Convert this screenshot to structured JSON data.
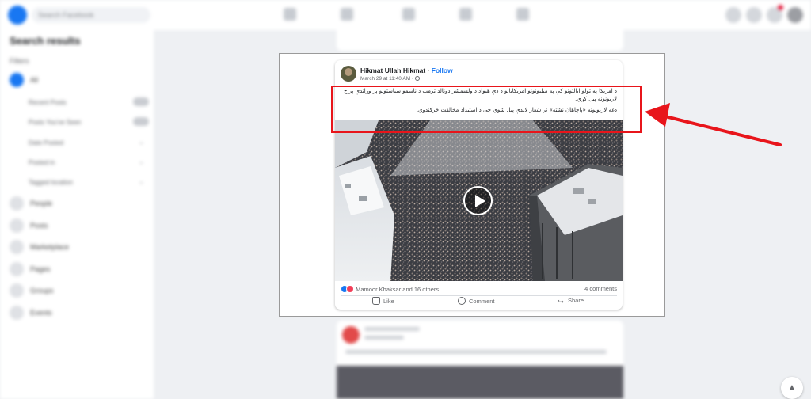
{
  "background": {
    "search_placeholder": "Search Facebook",
    "sidebar": {
      "title": "Search results",
      "filters_label": "Filters",
      "all_label": "All",
      "options": [
        "Recent Posts",
        "Posts You've Seen",
        "Date Posted",
        "Posted in",
        "Tagged location"
      ],
      "categories": [
        "People",
        "Posts",
        "Marketplace",
        "Pages",
        "Groups",
        "Events"
      ]
    }
  },
  "post": {
    "author": "Hikmat Ullah Hikmat",
    "separator": "·",
    "follow_label": "Follow",
    "timestamp": "March 29 at 11:40 AM ·",
    "text_line1": "د امریکا په ټولو ایالتونو کې په میلیونونو امریکایانو د دې هیواد د ولسمشر ډونالډ ټرمپ د ناسمو سیاستونو پر وړاندې پراخ لاریونونه پیل کړي.",
    "text_line2": "دغه لاریونونه «پاچاهان نشته» تر شعار لاندې پیل شوي چې د استبداد مخالفت څرګندوي.",
    "reactions_text": "Mamoor Khaksar and 16 others",
    "comments_count": "4 comments",
    "actions": {
      "like": "Like",
      "comment": "Comment",
      "share": "Share"
    }
  },
  "icons": {
    "avatar": "profile-photo",
    "play": "play-icon",
    "like_reaction": "like-reaction-icon",
    "love_reaction": "love-reaction-icon",
    "globe": "globe-icon"
  },
  "colors": {
    "facebook_blue": "#1877f2",
    "annotation_red": "#e8151b",
    "love_red": "#f33e58"
  }
}
